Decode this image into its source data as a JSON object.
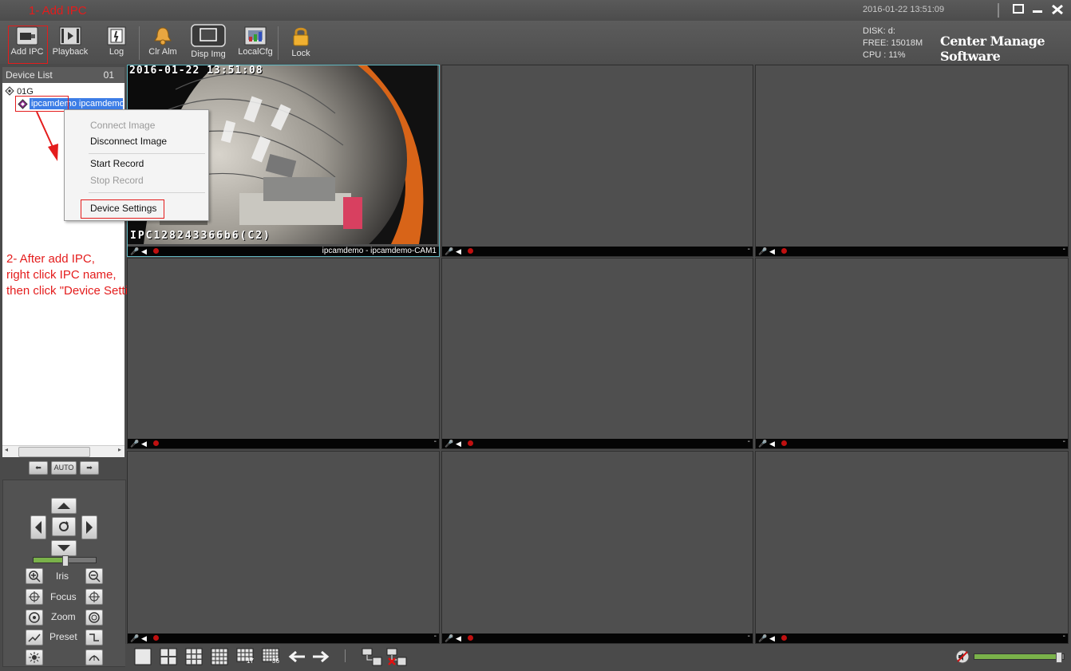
{
  "annotations": {
    "step1": "1- Add IPC",
    "step2_lines": [
      "2- After add IPC,",
      "right click IPC name,",
      "then click \"Device Setting\""
    ]
  },
  "titlebar": {
    "datetime": "2016-01-22 13:51:09"
  },
  "toolbar": {
    "buttons": [
      {
        "label": "Add IPC",
        "icon": "camera-icon"
      },
      {
        "label": "Playback",
        "icon": "film-icon"
      },
      {
        "label": "Log",
        "icon": "log-icon"
      },
      {
        "label": "Clr Alm",
        "icon": "bell-icon"
      },
      {
        "label": "Disp Img",
        "icon": "monitor-icon"
      },
      {
        "label": "LocalCfg",
        "icon": "config-icon"
      },
      {
        "label": "Lock",
        "icon": "lock-icon"
      }
    ]
  },
  "stats": {
    "disk": "DISK: d:",
    "free": "FREE: 15018M",
    "cpu": "CPU  : 11%"
  },
  "app_name": "Center Manage Software",
  "device_list": {
    "header": "Device List",
    "count": "01",
    "group": "01G",
    "device": "ipcamdemo ipcamdemo"
  },
  "context_menu": {
    "items": [
      {
        "label": "Connect Image",
        "enabled": false
      },
      {
        "label": "Disconnect Image",
        "enabled": true
      },
      {
        "label": "Start Record",
        "enabled": true
      },
      {
        "label": "Stop Record",
        "enabled": false
      },
      {
        "label": "Device Settings",
        "enabled": true
      }
    ]
  },
  "nav": {
    "auto": "AUTO"
  },
  "ptz": {
    "iris": "Iris",
    "focus": "Focus",
    "zoom": "Zoom",
    "preset": "Preset"
  },
  "video": {
    "timestamp": "2016-01-22 13:51:08",
    "overlay": "IPC128243366b6(C2)",
    "cam_name": "ipcamdemo - ipcamdemo-CAM1",
    "dash": "-"
  },
  "layouts": {
    "l17": "17",
    "l36": "36"
  },
  "colors": {
    "annotation": "#e41c1c",
    "selection": "#3c7de6",
    "active_cell_border": "#5fb6c0"
  }
}
